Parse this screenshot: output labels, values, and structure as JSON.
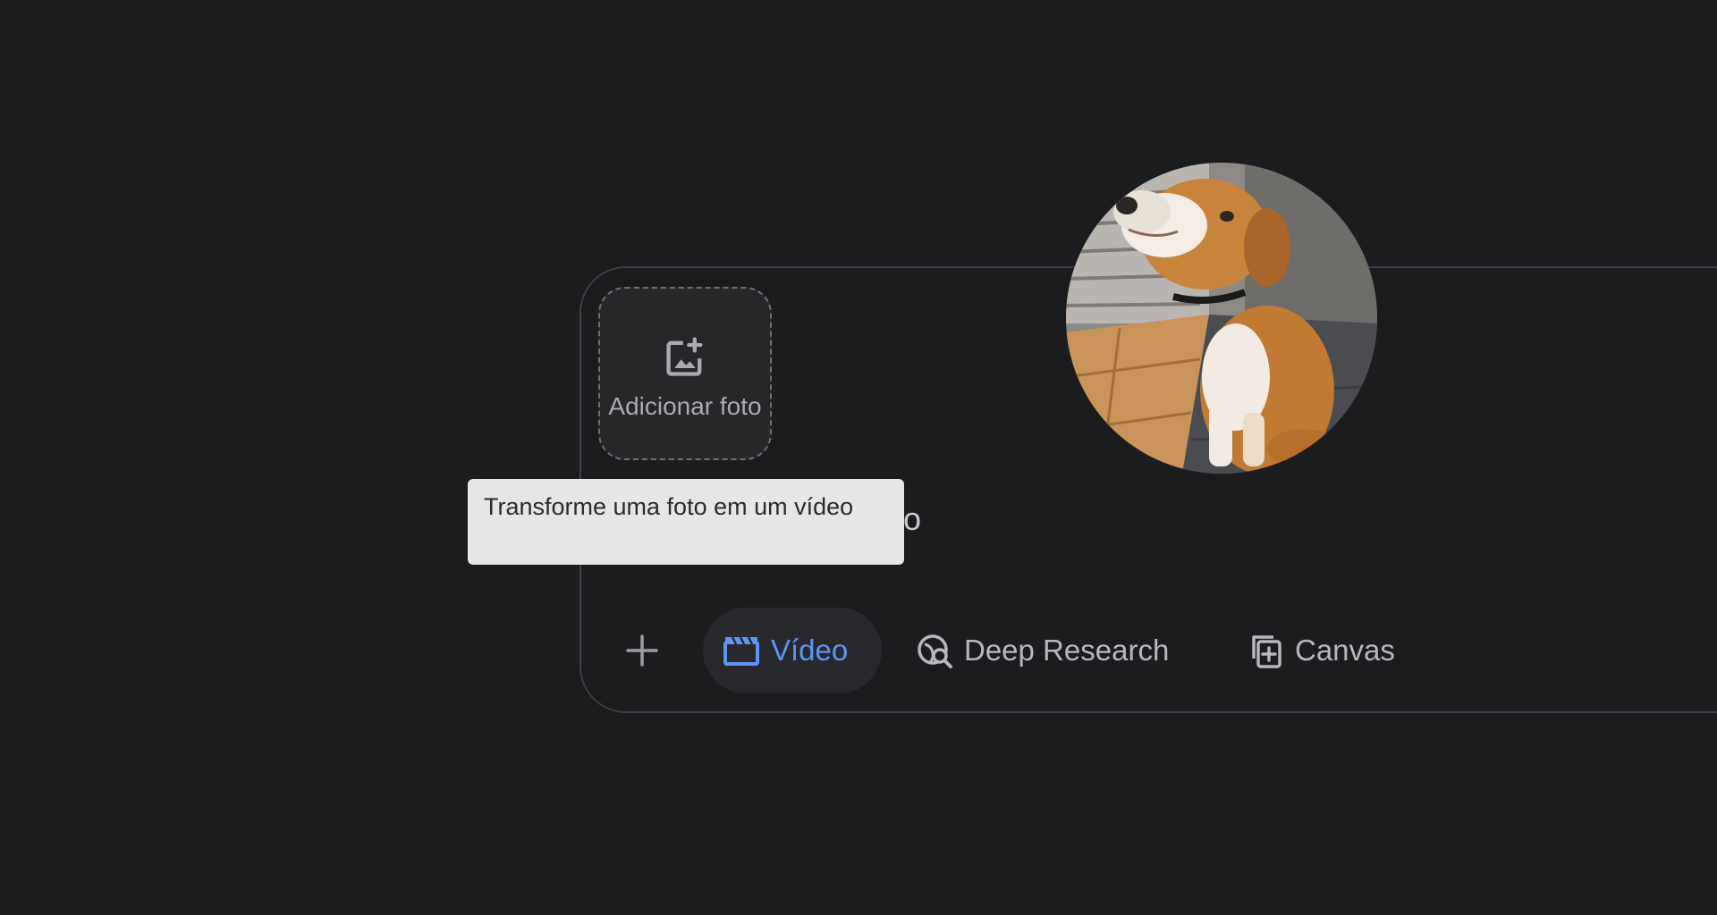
{
  "composer": {
    "add_photo_label": "Adicionar foto",
    "partial_visible_text": "eo"
  },
  "tooltip": {
    "text": "Transforme uma foto em um vídeo"
  },
  "avatar": {
    "description_icon": "dog-photo"
  },
  "toolbar": {
    "plus_icon": "plus-icon",
    "tools": [
      {
        "label": "Vídeo",
        "icon": "video-clapperboard-icon",
        "active": true
      },
      {
        "label": "Deep Research",
        "icon": "deep-research-icon",
        "active": false
      },
      {
        "label": "Canvas",
        "icon": "canvas-icon",
        "active": false
      }
    ]
  },
  "colors": {
    "background": "#1b1c1e",
    "accent": "#5c95f2",
    "tooltip_bg": "#e6e6e6",
    "border": "#3d3f42"
  }
}
